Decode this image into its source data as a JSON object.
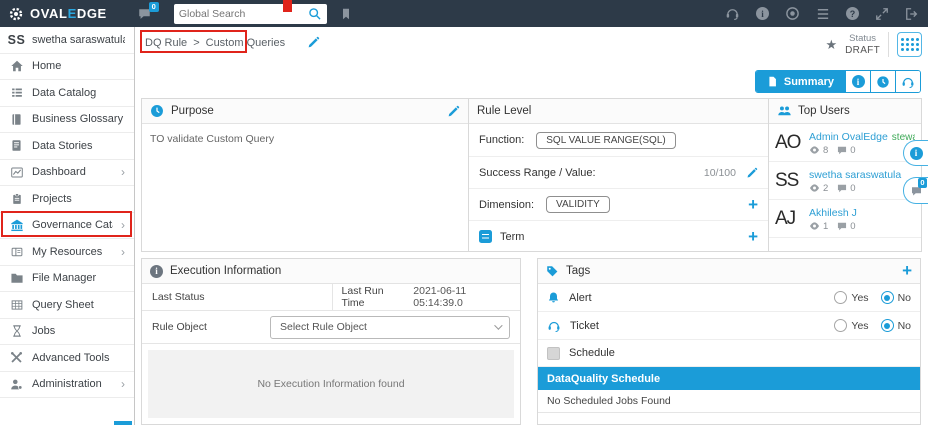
{
  "topbar": {
    "brand": {
      "part1": "OVAL",
      "accent": "E",
      "part2": "DGE"
    },
    "notification_badge": "0",
    "search": {
      "placeholder": "Global Search"
    }
  },
  "sidebar": {
    "user": {
      "initials": "SS",
      "name": "swetha saraswatula"
    },
    "items": [
      {
        "label": "Home",
        "has_submenu": false
      },
      {
        "label": "Data Catalog",
        "has_submenu": false
      },
      {
        "label": "Business Glossary",
        "has_submenu": false
      },
      {
        "label": "Data Stories",
        "has_submenu": false
      },
      {
        "label": "Dashboard",
        "has_submenu": true
      },
      {
        "label": "Projects",
        "has_submenu": false
      },
      {
        "label": "Governance Catalog",
        "has_submenu": true
      },
      {
        "label": "My Resources",
        "has_submenu": true
      },
      {
        "label": "File Manager",
        "has_submenu": false
      },
      {
        "label": "Query Sheet",
        "has_submenu": false
      },
      {
        "label": "Jobs",
        "has_submenu": false
      },
      {
        "label": "Advanced Tools",
        "has_submenu": false
      },
      {
        "label": "Administration",
        "has_submenu": true
      }
    ]
  },
  "breadcrumb": {
    "root": "DQ Rule",
    "separator": ">",
    "current": "Custom Queries"
  },
  "status": {
    "label": "Status",
    "value": "DRAFT"
  },
  "toolbar": {
    "summary": "Summary"
  },
  "panels": {
    "purpose": {
      "title": "Purpose",
      "body": "TO validate Custom Query"
    },
    "rule_level": {
      "title": "Rule Level",
      "function_label": "Function:",
      "function_value": "SQL VALUE RANGE(SQL)",
      "success_label": "Success Range / Value:",
      "success_value": "10/100",
      "dimension_label": "Dimension:",
      "dimension_value": "VALIDITY",
      "term_label": "Term"
    },
    "top_users": {
      "title": "Top Users",
      "users": [
        {
          "initials": "AO",
          "name": "Admin OvalEdge",
          "role": "steward ...",
          "views": "8",
          "comments": "0"
        },
        {
          "initials": "SS",
          "name": "swetha saraswatula",
          "role": "",
          "views": "2",
          "comments": "0"
        },
        {
          "initials": "AJ",
          "name": "Akhilesh J",
          "role": "",
          "views": "1",
          "comments": "0"
        }
      ]
    },
    "execution": {
      "title": "Execution Information",
      "last_status_label": "Last Status",
      "last_run_label": "Last Run Time",
      "last_run_value": "2021-06-11 05:14:39.0",
      "rule_object_label": "Rule Object",
      "rule_object_value": "Select Rule Object",
      "empty_message": "No Execution Information found"
    },
    "tags": {
      "title": "Tags",
      "alert_label": "Alert",
      "ticket_label": "Ticket",
      "schedule_label": "Schedule",
      "radio": {
        "yes": "Yes",
        "no": "No"
      },
      "banner": "DataQuality Schedule",
      "empty_message": "No Scheduled Jobs Found"
    }
  },
  "floating": {
    "chat_badge": "0"
  },
  "colors": {
    "accent_blue": "#1b9cd8",
    "topbar_bg": "#2d3a48",
    "annotation_red": "#e0241b",
    "link_blue": "#2e9fd4",
    "steward_green": "#3faa58",
    "banner_blue": "#1b9cd8"
  }
}
